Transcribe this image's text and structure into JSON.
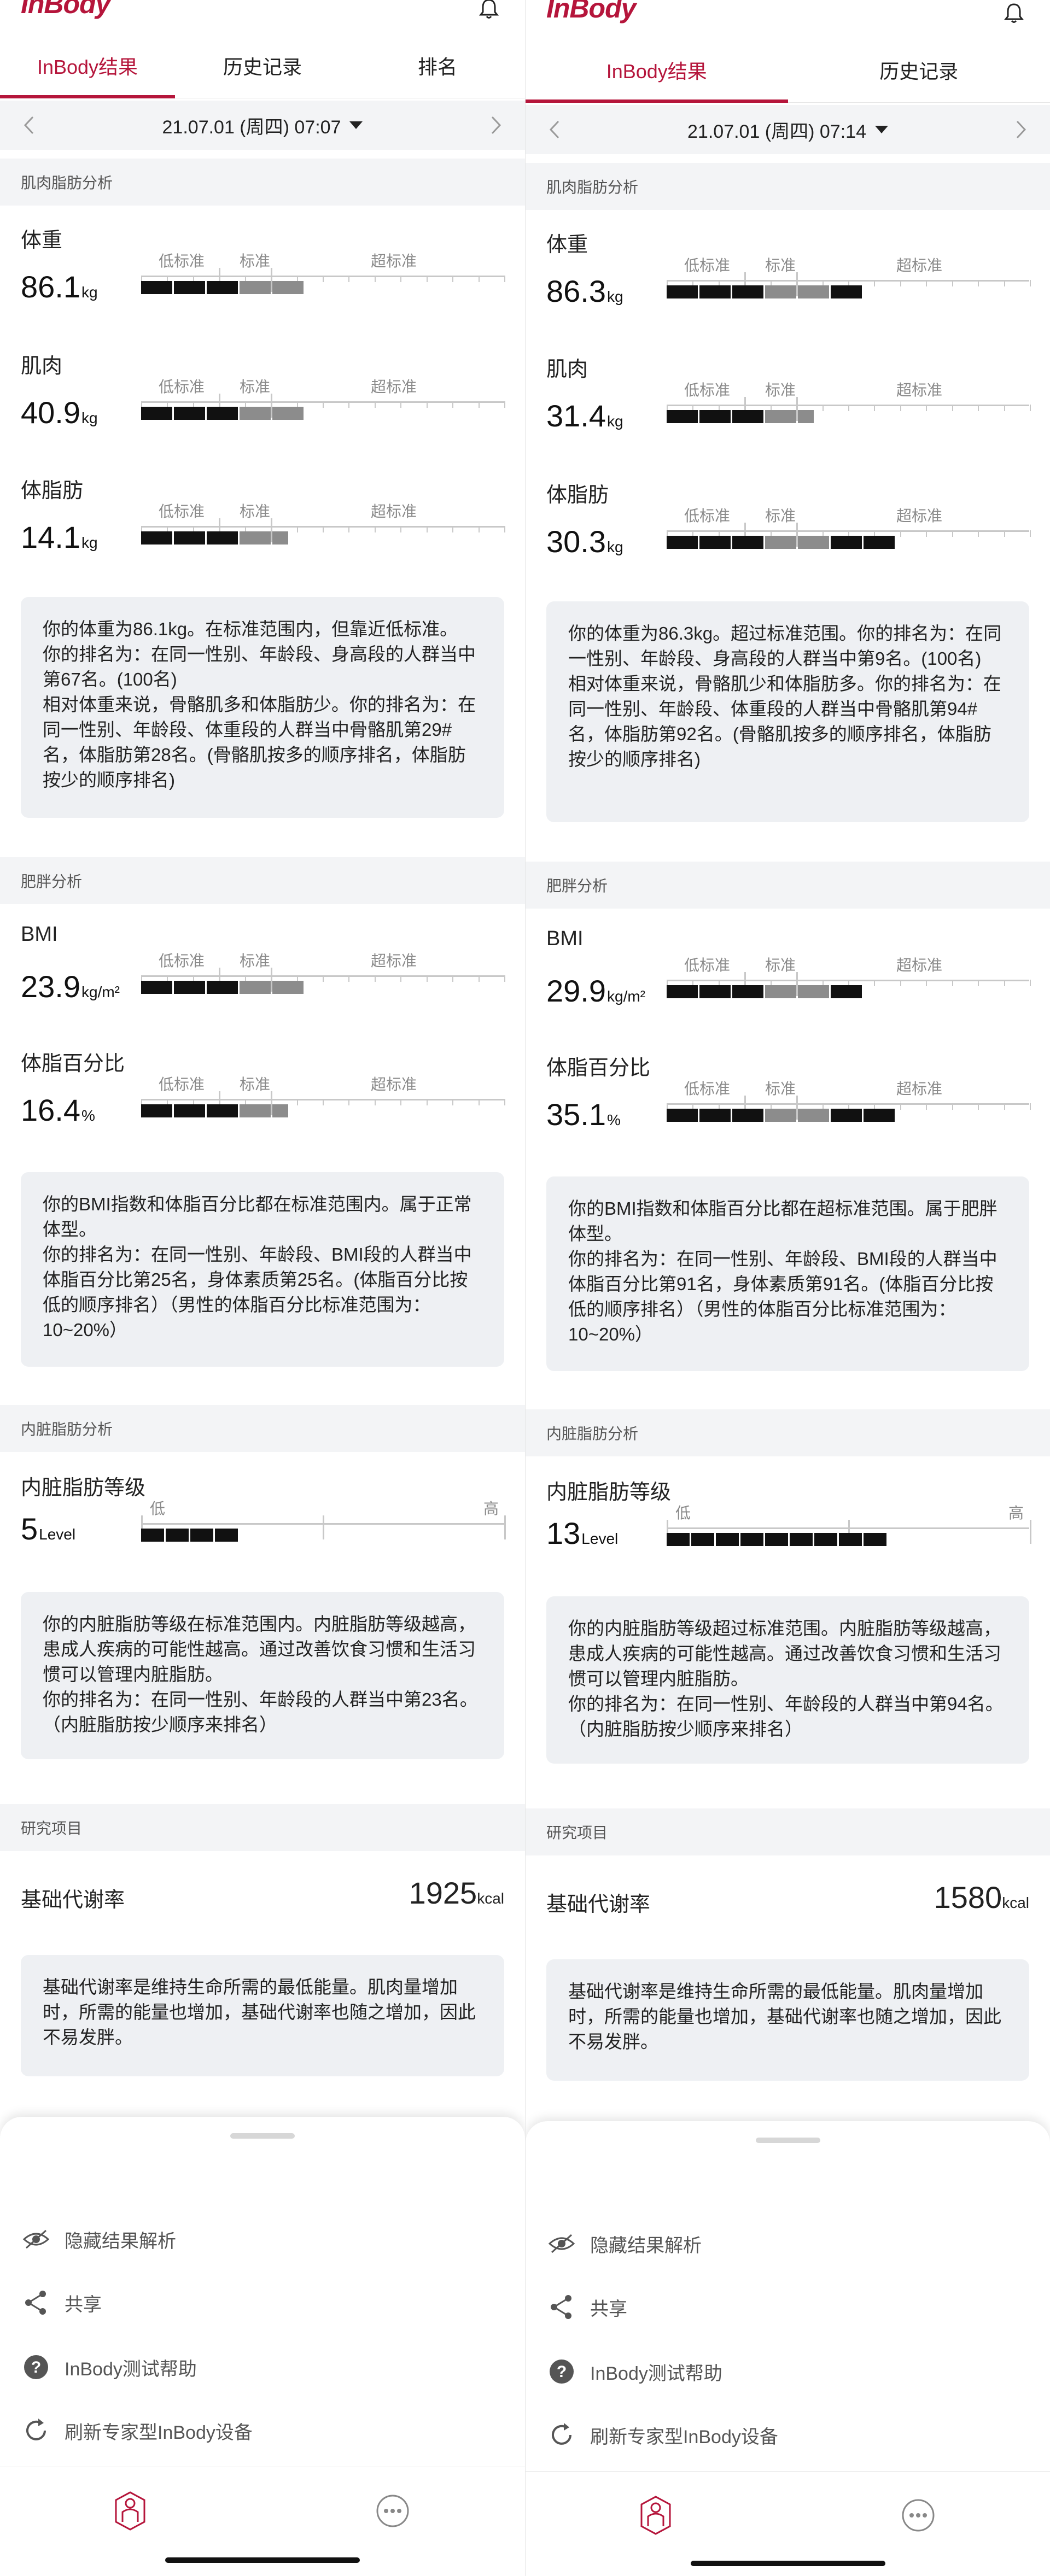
{
  "app": {
    "logo_text": "InBody",
    "brand_color": "#b5153b"
  },
  "colors": {
    "bar_low": "#111111",
    "bar_normal": "#8c8c8c",
    "bar_high": "#111111",
    "panel_bg": "#eef0f3"
  },
  "screens": [
    {
      "tabs": [
        {
          "label": "InBody结果",
          "active": true
        },
        {
          "label": "历史记录",
          "active": false
        },
        {
          "label": "排名",
          "active": false
        }
      ],
      "date_label": "21.07.01 (周四) 07:07",
      "sections": {
        "muscle_fat": "肌肉脂肪分析",
        "obesity": "肥胖分析",
        "visceral": "内脏脂肪分析",
        "research": "研究项目"
      },
      "zones": {
        "low": "低标准",
        "normal": "标准",
        "high": "超标准",
        "visceral_low": "低",
        "visceral_high": "高"
      },
      "metrics": {
        "weight": {
          "label": "体重",
          "value": "86.1",
          "unit": "kg",
          "low_segments": 3,
          "normal_segments": 2,
          "high_segments": 0
        },
        "muscle": {
          "label": "肌肉",
          "value": "40.9",
          "unit": "kg",
          "low_segments": 3,
          "normal_segments": 2,
          "high_segments": 0
        },
        "body_fat": {
          "label": "体脂肪",
          "value": "14.1",
          "unit": "kg",
          "low_segments": 3,
          "normal_segments": 1.5,
          "high_segments": 0
        },
        "bmi": {
          "label": "BMI",
          "value": "23.9",
          "unit": "kg/m²",
          "low_segments": 3,
          "normal_segments": 2,
          "high_segments": 0
        },
        "pbf": {
          "label": "体脂百分比",
          "value": "16.4",
          "unit": "%",
          "low_segments": 3,
          "normal_segments": 1.5,
          "high_segments": 0
        },
        "visceral": {
          "label": "内脏脂肪等级",
          "value": "5",
          "unit": "Level",
          "segments": 4
        }
      },
      "desc": {
        "muscle_fat": "你的体重为86.1kg。在标准范围内，但靠近低标准。\n你的排名为：在同一性别、年龄段、身高段的人群当中第67名。(100名)\n相对体重来说，骨骼肌多和体脂肪少。你的排名为：在同一性别、年龄段、体重段的人群当中骨骼肌第29#名，体脂肪第28名。(骨骼肌按多的顺序排名，体脂肪按少的顺序排名)",
        "obesity": "你的BMI指数和体脂百分比都在标准范围内。属于正常体型。\n你的排名为：在同一性别、年龄段、BMI段的人群当中体脂百分比第25名，身体素质第25名。(体脂百分比按低的顺序排名）（男性的体脂百分比标准范围为：10~20%）",
        "visceral": "你的内脏脂肪等级在标准范围内。内脏脂肪等级越高，患成人疾病的可能性越高。通过改善饮食习惯和生活习惯可以管理内脏脂肪。\n你的排名为：在同一性别、年龄段的人群当中第23名。（内脏脂肪按少顺序来排名）",
        "research": "基础代谢率是维持生命所需的最低能量。肌肉量增加时，所需的能量也增加，基础代谢率也随之增加，因此不易发胖。"
      },
      "research": {
        "label": "基础代谢率",
        "value": "1925",
        "unit": "kcal"
      },
      "menu": [
        "隐藏结果解析",
        "共享",
        "InBody测试帮助",
        "刷新专家型InBody设备"
      ]
    },
    {
      "tabs": [
        {
          "label": "InBody结果",
          "active": true
        },
        {
          "label": "历史记录",
          "active": false
        }
      ],
      "date_label": "21.07.01 (周四) 07:14",
      "sections": {
        "muscle_fat": "肌肉脂肪分析",
        "obesity": "肥胖分析",
        "visceral": "内脏脂肪分析",
        "research": "研究项目"
      },
      "zones": {
        "low": "低标准",
        "normal": "标准",
        "high": "超标准",
        "visceral_low": "低",
        "visceral_high": "高"
      },
      "metrics": {
        "weight": {
          "label": "体重",
          "value": "86.3",
          "unit": "kg",
          "low_segments": 3,
          "normal_segments": 2,
          "high_segments": 1
        },
        "muscle": {
          "label": "肌肉",
          "value": "31.4",
          "unit": "kg",
          "low_segments": 3,
          "normal_segments": 1.5,
          "high_segments": 0
        },
        "body_fat": {
          "label": "体脂肪",
          "value": "30.3",
          "unit": "kg",
          "low_segments": 3,
          "normal_segments": 2,
          "high_segments": 2
        },
        "bmi": {
          "label": "BMI",
          "value": "29.9",
          "unit": "kg/m²",
          "low_segments": 3,
          "normal_segments": 2,
          "high_segments": 1
        },
        "pbf": {
          "label": "体脂百分比",
          "value": "35.1",
          "unit": "%",
          "low_segments": 3,
          "normal_segments": 2,
          "high_segments": 2
        },
        "visceral": {
          "label": "内脏脂肪等级",
          "value": "13",
          "unit": "Level",
          "segments": 9
        }
      },
      "desc": {
        "muscle_fat": "你的体重为86.3kg。超过标准范围。你的排名为：在同一性别、年龄段、身高段的人群当中第9名。(100名)\n相对体重来说，骨骼肌少和体脂肪多。你的排名为：在同一性别、年龄段、体重段的人群当中骨骼肌第94#名，体脂肪第92名。(骨骼肌按多的顺序排名，体脂肪按少的顺序排名)",
        "obesity": "你的BMI指数和体脂百分比都在超标准范围。属于肥胖体型。\n你的排名为：在同一性别、年龄段、BMI段的人群当中体脂百分比第91名，身体素质第91名。(体脂百分比按低的顺序排名）（男性的体脂百分比标准范围为：10~20%）",
        "visceral": "你的内脏脂肪等级超过标准范围。内脏脂肪等级越高，患成人疾病的可能性越高。通过改善饮食习惯和生活习惯可以管理内脏脂肪。\n你的排名为：在同一性别、年龄段的人群当中第94名。（内脏脂肪按少顺序来排名）",
        "research": "基础代谢率是维持生命所需的最低能量。肌肉量增加时，所需的能量也增加，基础代谢率也随之增加，因此不易发胖。"
      },
      "research": {
        "label": "基础代谢率",
        "value": "1580",
        "unit": "kcal"
      },
      "menu": [
        "隐藏结果解析",
        "共享",
        "InBody测试帮助",
        "刷新专家型InBody设备"
      ]
    }
  ]
}
